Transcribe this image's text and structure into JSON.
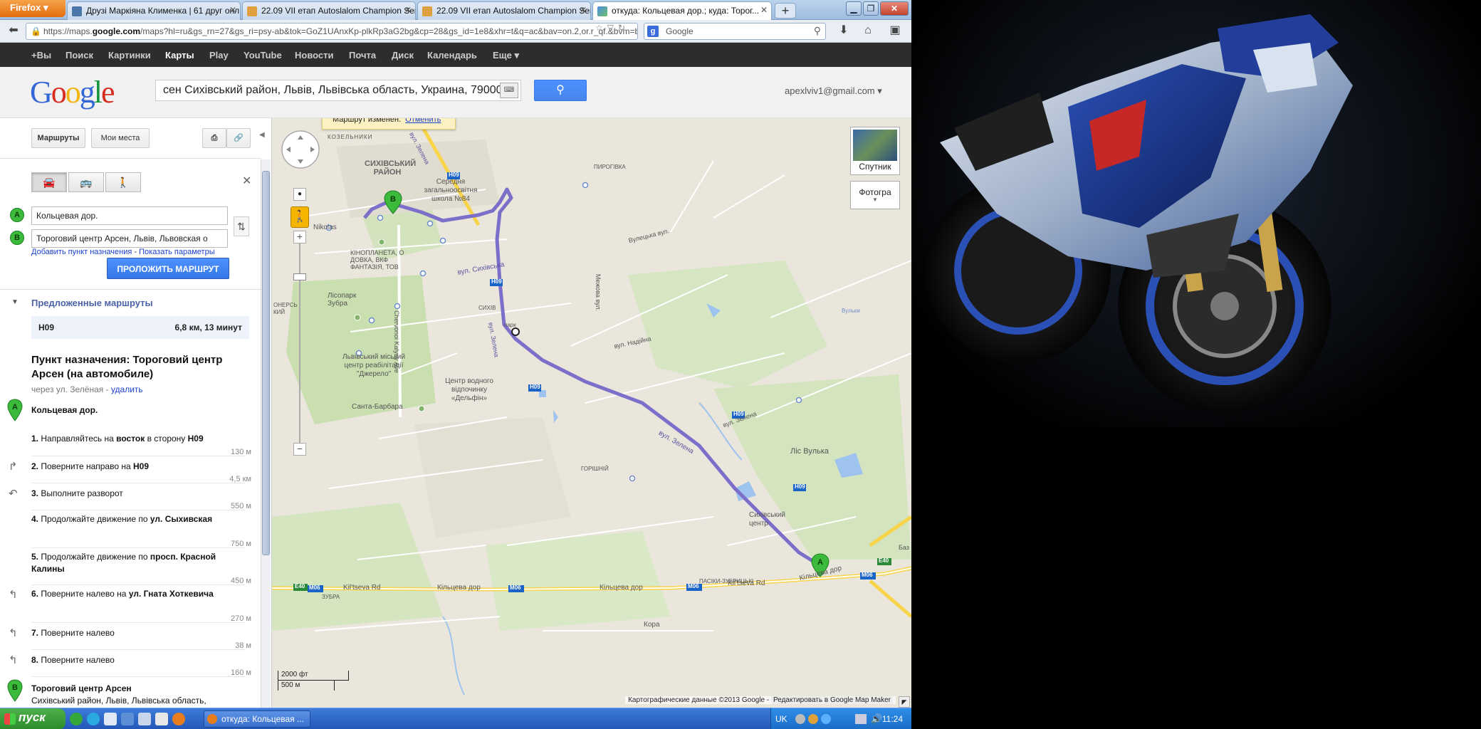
{
  "browser": {
    "firefox_label": "Firefox",
    "tabs": [
      {
        "label": "Друзі Маркіяна Клименка | 61 друг онл...",
        "active": false
      },
      {
        "label": "22.09 VII етап Autoslalom Champion Seri...",
        "active": false
      },
      {
        "label": "22.09 VII етап Autoslalom Champion Seri...",
        "active": false
      },
      {
        "label": "откуда: Кольцевая дор.; куда: Торог...",
        "active": true
      }
    ],
    "new_tab": "+",
    "url_prefix": "https://maps.",
    "url_domain": "google.com",
    "url_rest": "/maps?hl=ru&gs_rn=27&gs_ri=psy-ab&tok=GoZ1UAnxKp-plkRp3aG2bg&cp=28&gs_id=1e8&xhr=t&q=ac&bav=on.2,or.r_qf.&bvm=bv.5",
    "search_placeholder": "Google"
  },
  "gbar": {
    "items": [
      {
        "label": "+Вы",
        "selected": false
      },
      {
        "label": "Поиск",
        "selected": false
      },
      {
        "label": "Картинки",
        "selected": false
      },
      {
        "label": "Карты",
        "selected": true
      },
      {
        "label": "Play",
        "selected": false
      },
      {
        "label": "YouTube",
        "selected": false
      },
      {
        "label": "Новости",
        "selected": false
      },
      {
        "label": "Почта",
        "selected": false
      },
      {
        "label": "Диск",
        "selected": false
      },
      {
        "label": "Календарь",
        "selected": false
      },
      {
        "label": "Еще ▾",
        "selected": false
      }
    ]
  },
  "header": {
    "logo_letters": [
      "G",
      "o",
      "o",
      "g",
      "l",
      "e"
    ],
    "search_value": "сен Сихівський район, Львів, Львівська область, Украина, 79000",
    "account": "apexlviv1@gmail.com ▾"
  },
  "panel": {
    "routes_btn": "Маршруты",
    "my_places_btn": "Мои места",
    "origin": "Кольцевая дор.",
    "destination": "Тороговий центр Арсен, Львів, Львовская о",
    "add_destination": "Добавить пункт назначения",
    "show_options": "Показать параметры",
    "separator": " - ",
    "build_route": "ПРОЛОЖИТЬ МАРШРУТ",
    "suggested": "Предложенные маршруты",
    "route_name": "H09",
    "route_info": "6,8 км, 13 минут",
    "dest_title": "Пункт назначения: Тороговий центр Арсен (на автомобиле)",
    "via_text": "через ул. Зелёная - ",
    "via_delete": "удалить",
    "start_label": "Кольцевая дор.",
    "steps": [
      {
        "num": "1.",
        "text": "Направляйтесь на ",
        "bold": "восток",
        "after": " в сторону ",
        "bold2": "H09",
        "dist": "130 м"
      },
      {
        "num": "2.",
        "text": "Поверните направо на ",
        "bold": "H09",
        "after": "",
        "bold2": "",
        "dist": "4,5 км"
      },
      {
        "num": "3.",
        "text": "Выполните разворот",
        "bold": "",
        "after": "",
        "bold2": "",
        "dist": "550 м"
      },
      {
        "num": "4.",
        "text": "Продолжайте движение по ",
        "bold": "ул. Сыхивская",
        "after": "",
        "bold2": "",
        "dist": "750 м"
      },
      {
        "num": "5.",
        "text": "Продолжайте движение по ",
        "bold": "просп. Красной Калины",
        "after": "",
        "bold2": "",
        "dist": "450 м"
      },
      {
        "num": "6.",
        "text": "Поверните налево на ",
        "bold": "ул. Гната Хоткевича",
        "after": "",
        "bold2": "",
        "dist": "270 м"
      },
      {
        "num": "7.",
        "text": "Поверните налево",
        "bold": "",
        "after": "",
        "bold2": "",
        "dist": "38 м"
      },
      {
        "num": "8.",
        "text": "Поверните налево",
        "bold": "",
        "after": "",
        "bold2": "",
        "dist": "160 м"
      }
    ],
    "end_title": "Тороговий центр Арсен",
    "end_address": "Сихівський район, Львів, Львівська область,"
  },
  "map": {
    "notice": "Маршрут изменен.",
    "notice_undo": "Отменить",
    "satellite": "Спутник",
    "photos": "Фотогра",
    "scale_ft": "2000 фт",
    "scale_m": "500 м",
    "copyright": "Картографические данные ©2013 Google -",
    "edit_link": "Редактировать в Google Map Maker",
    "labels": {
      "kozelnyky": "КОЗЕЛЬНИКИ",
      "sykhivskyi": "СИХІВСЬКИЙ РАЙОН",
      "school": "Середня загальноосвітня школа №84",
      "pyrohivka": "ПИРОГІВКА",
      "nikolas": "Nikolas",
      "kinoplaneta": "КІНОПЛАНЕТА, О ДОВКА, ВКФ ФАНТАЗІЯ, ТОВ",
      "zelena_road": "вул. Сихівська",
      "vuletska": "Вулецька вул.",
      "mezheva": "Межова вул.",
      "lisopark": "Лісопарк Зубра",
      "sykhiv": "СИХІВ",
      "park": "парк",
      "chervonoi": "Chervonoi Kalyny Ave",
      "rehab": "Львівський міський центр реабілітації \"Джерело\"",
      "water": "Центр водного відпочинку «Дельфін»",
      "nadiina": "вул. Надійна",
      "santa": "Санта-Барбара",
      "horishni": "ГОРІШНІЙ",
      "zelena": "вул. Зелена",
      "zelena2": "вул. Зелена",
      "lis_vulka": "Ліс Вулька",
      "sykh_center": "Сихівський центр",
      "zubra": "ЗУБРА",
      "pasiky": "ПАСІКИ-ЗУБРИЦЬКІ",
      "kiltseva": "Kil'tseva Rd",
      "kiltseva2": "Кільцева дор",
      "kiltseva3": "Кільцева дор",
      "kiltseva4": "Kil'tseva Rd",
      "kiltseva5": "Кільцева дор",
      "kora": "Кора",
      "vulky": "Вульки",
      "oncer": "ОНЕРСЬ КИЙ",
      "baz": "Баз",
      "zelena_v": "вул. Зелена",
      "h09": "H09",
      "m06": "M06",
      "e40": "E40",
      "zelena_top": "вул. Зелена"
    }
  },
  "taskbar": {
    "start": "пуск",
    "task": "откуда: Кольцевая ...",
    "lang": "UK",
    "clock": "11:24"
  }
}
